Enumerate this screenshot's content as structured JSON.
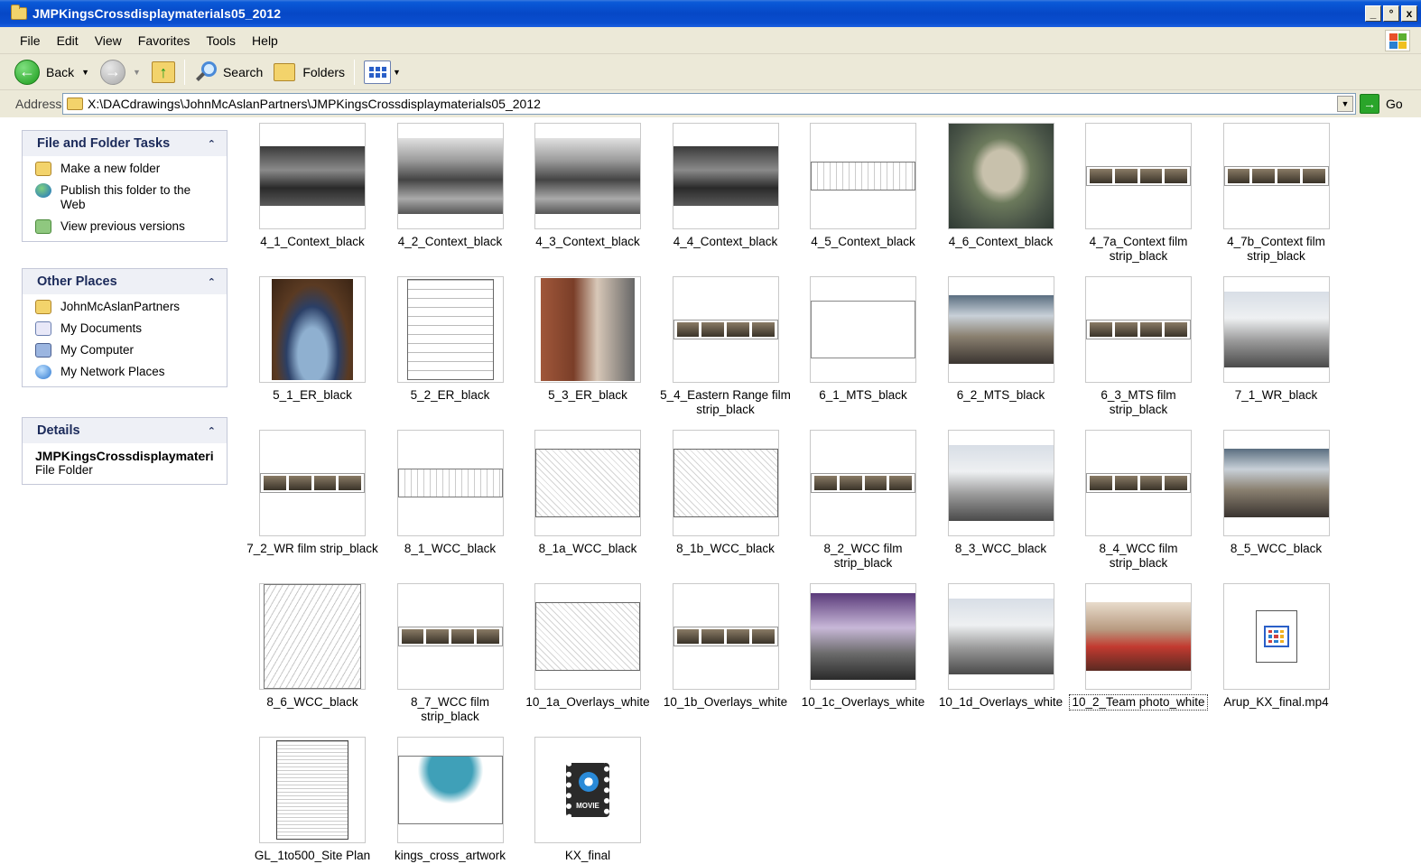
{
  "window": {
    "title": "JMPKingsCrossdisplaymaterials05_2012",
    "controls": [
      "_",
      "°",
      "x"
    ]
  },
  "menu": [
    "File",
    "Edit",
    "View",
    "Favorites",
    "Tools",
    "Help"
  ],
  "toolbar": {
    "back_label": "Back",
    "search_label": "Search",
    "folders_label": "Folders"
  },
  "address": {
    "label": "Address",
    "path": "X:\\DACdrawings\\JohnMcAslanPartners\\JMPKingsCrossdisplaymaterials05_2012",
    "go_label": "Go"
  },
  "sidebar": {
    "file_tasks": {
      "title": "File and Folder Tasks",
      "items": [
        "Make a new folder",
        "Publish this folder to the Web",
        "View previous versions"
      ]
    },
    "other_places": {
      "title": "Other Places",
      "items": [
        "JohnMcAslanPartners",
        "My Documents",
        "My Computer",
        "My Network Places"
      ]
    },
    "details": {
      "title": "Details",
      "name": "JMPKingsCrossdisplaymateri",
      "type": "File Folder"
    }
  },
  "files": [
    {
      "name": "4_1_Context_black",
      "thumb": "photo-bw"
    },
    {
      "name": "4_2_Context_black",
      "thumb": "photo-bw2"
    },
    {
      "name": "4_3_Context_black",
      "thumb": "photo-bw2"
    },
    {
      "name": "4_4_Context_black",
      "thumb": "photo-bw"
    },
    {
      "name": "4_5_Context_black",
      "thumb": "sketch"
    },
    {
      "name": "4_6_Context_black",
      "thumb": "aerial"
    },
    {
      "name": "4_7a_Context film strip_black",
      "thumb": "strip"
    },
    {
      "name": "4_7b_Context film strip_black",
      "thumb": "strip"
    },
    {
      "name": "5_1_ER_black",
      "thumb": "arch-warm"
    },
    {
      "name": "5_2_ER_black",
      "thumb": "section"
    },
    {
      "name": "5_3_ER_black",
      "thumb": "brick"
    },
    {
      "name": "5_4_Eastern Range film strip_black",
      "thumb": "strip"
    },
    {
      "name": "6_1_MTS_black",
      "thumb": "arches"
    },
    {
      "name": "6_2_MTS_black",
      "thumb": "concourse"
    },
    {
      "name": "6_3_MTS film strip_black",
      "thumb": "strip"
    },
    {
      "name": "7_1_WR_black",
      "thumb": "white-hall"
    },
    {
      "name": "7_2_WR film strip_black",
      "thumb": "strip"
    },
    {
      "name": "8_1_WCC_black",
      "thumb": "sketch"
    },
    {
      "name": "8_1a_WCC_black",
      "thumb": "plan"
    },
    {
      "name": "8_1b_WCC_black",
      "thumb": "plan"
    },
    {
      "name": "8_2_WCC film strip_black",
      "thumb": "strip"
    },
    {
      "name": "8_3_WCC_black",
      "thumb": "white-hall"
    },
    {
      "name": "8_4_WCC film strip_black",
      "thumb": "strip"
    },
    {
      "name": "8_5_WCC_black",
      "thumb": "concourse"
    },
    {
      "name": "8_6_WCC_black",
      "thumb": "canopy"
    },
    {
      "name": "8_7_WCC film strip_black",
      "thumb": "strip"
    },
    {
      "name": "10_1a_Overlays_white",
      "thumb": "plan"
    },
    {
      "name": "10_1b_Overlays_white",
      "thumb": "strip"
    },
    {
      "name": "10_1c_Overlays_white",
      "thumb": "purple"
    },
    {
      "name": "10_1d_Overlays_white",
      "thumb": "white-hall"
    },
    {
      "name": "10_2_Team photo_white",
      "thumb": "crowd",
      "selected": true
    },
    {
      "name": "Arup_KX_final.mp4",
      "thumb": "file-ico"
    },
    {
      "name": "GL_1to500_Site Plan",
      "thumb": "siteplan"
    },
    {
      "name": "kings_cross_artwork",
      "thumb": "teal"
    },
    {
      "name": "KX_final",
      "thumb": "movie-ico"
    }
  ]
}
